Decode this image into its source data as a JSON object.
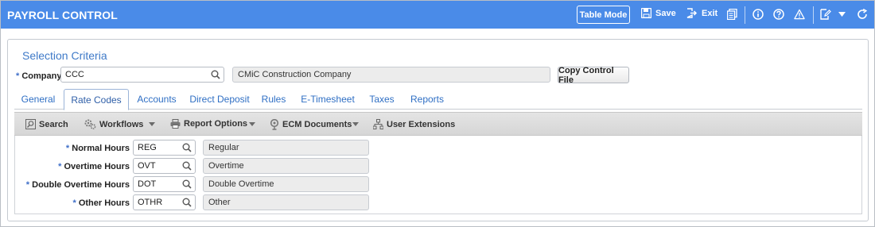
{
  "header": {
    "title": "PAYROLL CONTROL",
    "table_mode_label": "Table Mode",
    "save_label": "Save",
    "exit_label": "Exit"
  },
  "selection": {
    "title": "Selection Criteria",
    "company_label": "Company",
    "company_value": "CCC",
    "company_name": "CMiC Construction Company",
    "copy_button": "Copy Control File"
  },
  "tabs": [
    {
      "label": "General"
    },
    {
      "label": "Rate Codes"
    },
    {
      "label": "Accounts"
    },
    {
      "label": "Direct Deposit"
    },
    {
      "label": "Rules"
    },
    {
      "label": "E-Timesheet"
    },
    {
      "label": "Taxes"
    },
    {
      "label": "Reports"
    }
  ],
  "active_tab": "Rate Codes",
  "toolbar": {
    "search": "Search",
    "workflows": "Workflows",
    "report_options": "Report Options",
    "ecm_documents": "ECM Documents",
    "user_extensions": "User Extensions"
  },
  "rate_codes": [
    {
      "label": "Normal Hours",
      "code": "REG",
      "description": "Regular"
    },
    {
      "label": "Overtime Hours",
      "code": "OVT",
      "description": "Overtime"
    },
    {
      "label": "Double Overtime Hours",
      "code": "DOT",
      "description": "Double Overtime"
    },
    {
      "label": "Other Hours",
      "code": "OTHR",
      "description": "Other"
    }
  ],
  "required_marker": "*",
  "colors": {
    "header_bg": "#4a8be8",
    "link_blue": "#2f6fc4"
  }
}
